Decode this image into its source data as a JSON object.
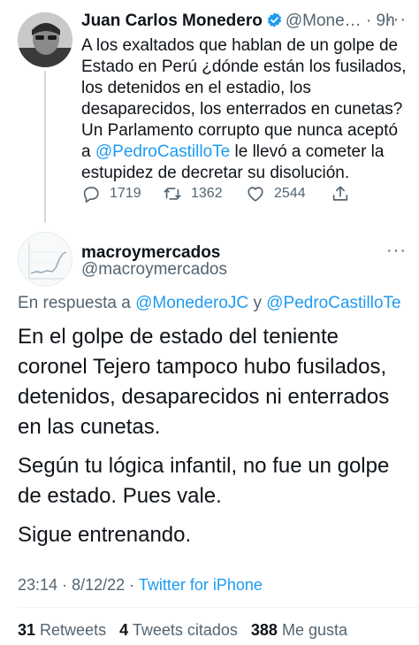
{
  "parent_tweet": {
    "author_name": "Juan Carlos Monedero",
    "handle": "@Mone…",
    "separator": "·",
    "time": "9h",
    "text_before": "A los exaltados que hablan de un golpe de Estado en Perú ¿dónde están los fusilados, los detenidos en el estadio, los desaparecidos, los enterrados en cunetas? Un Parlamento corrupto que nunca aceptó a ",
    "mention": "@PedroCastilloTe",
    "text_after": " le llevó a cometer la estupidez de decretar su disolución.",
    "replies": "1719",
    "retweets": "1362",
    "likes": "2544",
    "more": "···"
  },
  "main_tweet": {
    "author_name": "macroymercados",
    "handle": "@macroymercados",
    "more": "···",
    "reply_prefix": "En respuesta a",
    "reply_mention_1": "@MonederoJC",
    "reply_and": "y",
    "reply_mention_2": "@PedroCastilloTe",
    "paragraphs": [
      "En el golpe de estado del teniente coronel Tejero tampoco hubo fusilados, detenidos, desaparecidos ni enterrados en las cunetas.",
      "Según tu lógica infantil, no fue un golpe de estado. Pues vale.",
      "Sigue entrenando."
    ],
    "time": "23:14",
    "separator": "·",
    "date": "8/12/22",
    "source": "Twitter for iPhone",
    "stats": {
      "retweets_count": "31",
      "retweets_label": "Retweets",
      "quotes_count": "4",
      "quotes_label": "Tweets citados",
      "likes_count": "388",
      "likes_label": "Me gusta"
    }
  },
  "colors": {
    "accent": "#1d9bf0",
    "text_primary": "#0f1419",
    "text_secondary": "#536471",
    "thread_line": "#cfd9de"
  },
  "icons": [
    "verified-badge-icon",
    "reply-icon",
    "retweet-icon",
    "like-icon",
    "share-icon"
  ]
}
